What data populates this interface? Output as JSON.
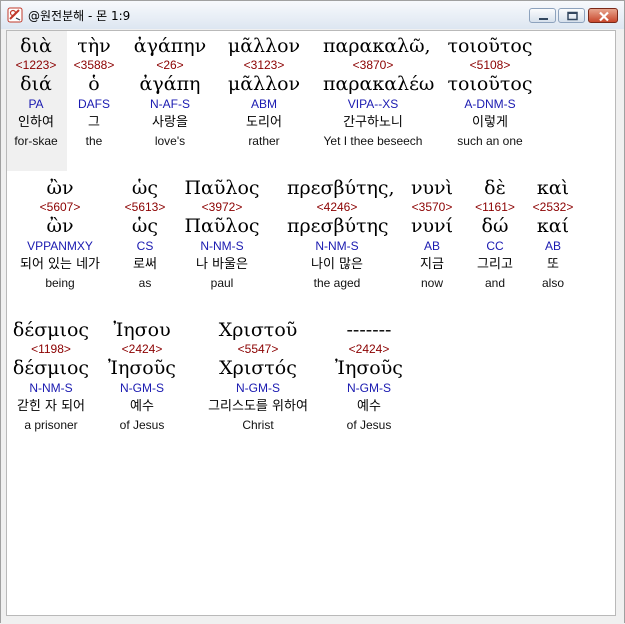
{
  "window": {
    "title": "@원전분해 - 몬 1:9"
  },
  "rows": [
    {
      "words": [
        {
          "greek": "διὰ",
          "strong": "<1223>",
          "lemma": "διά",
          "parse": "PA",
          "korean": "인하여",
          "english": "for-skae"
        },
        {
          "greek": "τὴν",
          "strong": "<3588>",
          "lemma": "ὁ",
          "parse": "DAFS",
          "korean": "그",
          "english": "the"
        },
        {
          "greek": "ἀγάπην",
          "strong": "<26>",
          "lemma": "ἀγάπη",
          "parse": "N-AF-S",
          "korean": "사랑을",
          "english": "love's"
        },
        {
          "greek": "μᾶλλον",
          "strong": "<3123>",
          "lemma": "μᾶλλον",
          "parse": "ABM",
          "korean": "도리어",
          "english": "rather"
        },
        {
          "greek": "παρακαλῶ,",
          "strong": "<3870>",
          "lemma": "παρακαλέω",
          "parse": "VIPA--XS",
          "korean": "간구하노니",
          "english": "Yet I thee beseech"
        },
        {
          "greek": "τοιοῦτος",
          "strong": "<5108>",
          "lemma": "τοιοῦτος",
          "parse": "A-DNM-S",
          "korean": "이렇게",
          "english": "such an one"
        }
      ]
    },
    {
      "words": [
        {
          "greek": "ὢν",
          "strong": "<5607>",
          "lemma": "ὢν",
          "parse": "VPPANMXY",
          "korean": "되어 있는 네가",
          "english": "being"
        },
        {
          "greek": "ὡς",
          "strong": "<5613>",
          "lemma": "ὡς",
          "parse": "CS",
          "korean": "로써",
          "english": "as"
        },
        {
          "greek": "Παῦλος",
          "strong": "<3972>",
          "lemma": "Παῦλος",
          "parse": "N-NM-S",
          "korean": "나 바울은",
          "english": "paul"
        },
        {
          "greek": "πρεσβύτης,",
          "strong": "<4246>",
          "lemma": "πρεσβύτης",
          "parse": "N-NM-S",
          "korean": "나이 많은",
          "english": "the aged"
        },
        {
          "greek": "νυνὶ",
          "strong": "<3570>",
          "lemma": "νυνί",
          "parse": "AB",
          "korean": "지금",
          "english": "now"
        },
        {
          "greek": "δὲ",
          "strong": "<1161>",
          "lemma": "δώ",
          "parse": "CC",
          "korean": "그리고",
          "english": "and"
        },
        {
          "greek": "καὶ",
          "strong": "<2532>",
          "lemma": "καί",
          "parse": "AB",
          "korean": "또",
          "english": "also"
        }
      ]
    },
    {
      "words": [
        {
          "greek": "δέσμιος",
          "strong": "<1198>",
          "lemma": "δέσμιος",
          "parse": "N-NM-S",
          "korean": "갇힌 자 되어",
          "english": "a prisoner"
        },
        {
          "greek": "Ἰησου",
          "strong": "<2424>",
          "lemma": "Ἰησοῦς",
          "parse": "N-GM-S",
          "korean": "예수",
          "english": "of Jesus"
        },
        {
          "greek": "Χριστοῦ",
          "strong": "<5547>",
          "lemma": "Χριστός",
          "parse": "N-GM-S",
          "korean": "그리스도를 위하여",
          "english": "Christ"
        },
        {
          "greek": "-------",
          "strong": "<2424>",
          "lemma": "Ἰησοῦς",
          "parse": "N-GM-S",
          "korean": "예수",
          "english": "of Jesus"
        }
      ]
    }
  ]
}
